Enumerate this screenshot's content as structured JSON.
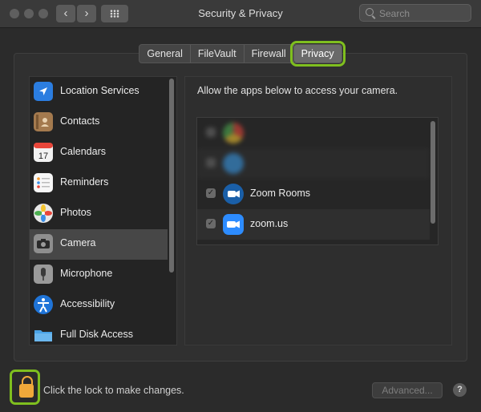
{
  "window": {
    "title": "Security & Privacy",
    "search_placeholder": "Search",
    "nav_back_icon": "chevron-left-icon",
    "nav_forward_icon": "chevron-right-icon",
    "back_glyph": "‹",
    "forward_glyph": "›"
  },
  "tabs": [
    {
      "label": "General",
      "selected": false
    },
    {
      "label": "FileVault",
      "selected": false
    },
    {
      "label": "Firewall",
      "selected": false
    },
    {
      "label": "Privacy",
      "selected": true
    }
  ],
  "sidebar": {
    "items": [
      {
        "label": "Location Services",
        "icon": "location-arrow-icon",
        "color": "#2b7de0"
      },
      {
        "label": "Contacts",
        "icon": "contacts-book-icon",
        "color": "#a47a4e"
      },
      {
        "label": "Calendars",
        "icon": "calendar-icon",
        "color": "#f2f2f2"
      },
      {
        "label": "Reminders",
        "icon": "reminders-list-icon",
        "color": "#f7f7f7"
      },
      {
        "label": "Photos",
        "icon": "photos-flower-icon",
        "color": "#e8e8e8"
      },
      {
        "label": "Camera",
        "icon": "camera-icon",
        "color": "#8e8e8e",
        "selected": true
      },
      {
        "label": "Microphone",
        "icon": "microphone-icon",
        "color": "#9a9a9a"
      },
      {
        "label": "Accessibility",
        "icon": "accessibility-icon",
        "color": "#1f74d8"
      },
      {
        "label": "Full Disk Access",
        "icon": "folder-icon",
        "color": "#4aa3e6"
      }
    ]
  },
  "content": {
    "heading": "Allow the apps below to access your camera.",
    "apps": [
      {
        "name": "",
        "checked": false,
        "blurred": true,
        "icon": "chrome-icon"
      },
      {
        "name": "",
        "checked": false,
        "blurred": true,
        "icon": "app-icon"
      },
      {
        "name": "Zoom Rooms",
        "checked": true,
        "blurred": false,
        "icon": "zoom-rooms-icon"
      },
      {
        "name": "zoom.us",
        "checked": true,
        "blurred": false,
        "icon": "zoom-icon"
      }
    ]
  },
  "footer": {
    "lock_text": "Click the lock to make changes.",
    "advanced_label": "Advanced...",
    "help_label": "?"
  },
  "colors": {
    "highlight": "#7fbf1f",
    "lock": "#f0a93a"
  }
}
